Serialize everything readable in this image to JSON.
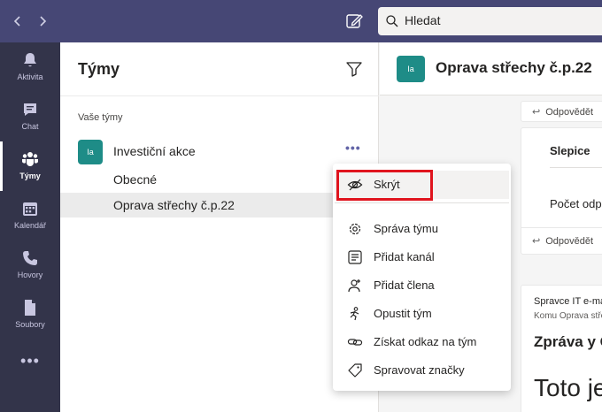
{
  "titlebar": {
    "back_icon": "chevron-left-icon",
    "forward_icon": "chevron-right-icon",
    "compose_icon": "compose-icon",
    "search_placeholder": "Hledat"
  },
  "appbar": {
    "items": [
      {
        "label": "Aktivita",
        "icon": "bell-icon"
      },
      {
        "label": "Chat",
        "icon": "chat-icon"
      },
      {
        "label": "Týmy",
        "icon": "teams-icon",
        "active": true
      },
      {
        "label": "Kalendář",
        "icon": "calendar-icon"
      },
      {
        "label": "Hovory",
        "icon": "phone-icon"
      },
      {
        "label": "Soubory",
        "icon": "file-icon"
      }
    ],
    "more": "•••"
  },
  "teams_panel": {
    "title": "Týmy",
    "filter_icon": "filter-icon",
    "section_label": "Vaše týmy",
    "team": {
      "avatar": "Ia",
      "name": "Investiční akce",
      "more": "•••"
    },
    "channels": [
      {
        "label": "Obecné"
      },
      {
        "label": "Oprava střechy č.p.22",
        "selected": true
      }
    ]
  },
  "channel_header": {
    "avatar": "Ia",
    "title": "Oprava střechy č.p.22"
  },
  "content": {
    "reply_label": "Odpovědět",
    "card1_title": "Slepice",
    "card1_text": "Počet odpovědí",
    "post_author": "Spravce IT e-mail",
    "post_to": "Komu Oprava střechy",
    "post_subject": "Zpráva y Outlooku",
    "post_body": "Toto je"
  },
  "context_menu": {
    "items": [
      {
        "label": "Skrýt",
        "icon": "hide-icon"
      },
      {
        "label": "Správa týmu",
        "icon": "gear-icon"
      },
      {
        "label": "Přidat kanál",
        "icon": "add-channel-icon"
      },
      {
        "label": "Přidat člena",
        "icon": "add-member-icon"
      },
      {
        "label": "Opustit tým",
        "icon": "leave-icon"
      },
      {
        "label": "Získat odkaz na tým",
        "icon": "link-icon"
      },
      {
        "label": "Spravovat značky",
        "icon": "tag-icon"
      }
    ],
    "highlight_color": "#e0141e"
  },
  "colors": {
    "titlebar": "#464775",
    "appbar": "#33344a",
    "team_avatar": "#1e8c87",
    "accent": "#6264a7"
  }
}
